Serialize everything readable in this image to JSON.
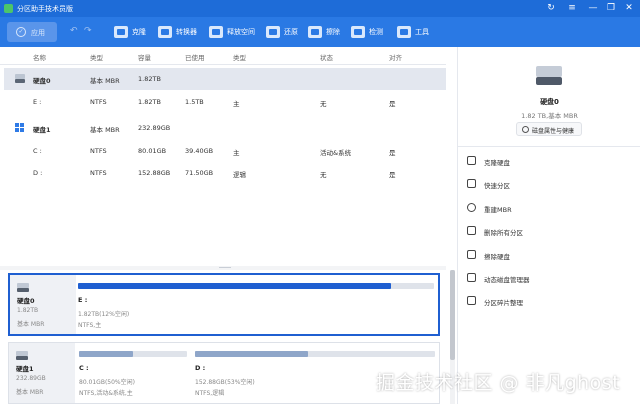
{
  "titlebar": {
    "title": "分区助手技术员版",
    "refresh_glyph": "↻",
    "menu_glyph": "≡",
    "minimize_glyph": "—",
    "restore_glyph": "❐",
    "close_glyph": "✕"
  },
  "toolbar": {
    "apply_label": "应用",
    "undo_glyph": "↶",
    "redo_glyph": "↷",
    "items": [
      {
        "label": "克隆",
        "icon": "clone-icon"
      },
      {
        "label": "转换器",
        "icon": "convert-icon"
      },
      {
        "label": "释放空间",
        "icon": "free-space-icon"
      },
      {
        "label": "还原",
        "icon": "restore-icon"
      },
      {
        "label": "擦除",
        "icon": "wipe-icon"
      },
      {
        "label": "检测",
        "icon": "check-icon"
      },
      {
        "label": "工具",
        "icon": "tools-icon"
      }
    ]
  },
  "table": {
    "headers": [
      "名称",
      "类型",
      "容量",
      "已使用",
      "类型",
      "状态",
      "对齐"
    ],
    "rows": [
      {
        "name": "硬盘0",
        "type": "基本 MBR",
        "capacity": "1.82TB",
        "used": "",
        "fstype": "",
        "status": "",
        "align": ""
      },
      {
        "name": "E :",
        "type": "NTFS",
        "capacity": "1.82TB",
        "used": "1.5TB",
        "fstype": "主",
        "status": "无",
        "align": "是"
      },
      {
        "name": "硬盘1",
        "type": "基本 MBR",
        "capacity": "232.89GB",
        "used": "",
        "fstype": "",
        "status": "",
        "align": ""
      },
      {
        "name": "C :",
        "type": "NTFS",
        "capacity": "80.01GB",
        "used": "39.40GB",
        "fstype": "主",
        "status": "活动&系统",
        "align": "是"
      },
      {
        "name": "D :",
        "type": "NTFS",
        "capacity": "152.88GB",
        "used": "71.50GB",
        "fstype": "逻辑",
        "status": "无",
        "align": "是"
      }
    ]
  },
  "disks": [
    {
      "name": "硬盘0",
      "size": "1.82TB",
      "type": "基本 MBR",
      "partitions": [
        {
          "name": "E :",
          "cap": "1.82TB(12%空闲)",
          "fs": "NTFS,主",
          "used_fraction": 0.88,
          "fill_color": "#1f5fd1"
        }
      ]
    },
    {
      "name": "硬盘1",
      "size": "232.89GB",
      "type": "基本 MBR",
      "partitions": [
        {
          "name": "C :",
          "cap": "80.01GB(50%空闲)",
          "fs": "NTFS,活动&系统,主",
          "used_fraction": 0.5,
          "fill_color": "#8fa6c9"
        },
        {
          "name": "D :",
          "cap": "152.88GB(53%空闲)",
          "fs": "NTFS,逻辑",
          "used_fraction": 0.47,
          "fill_color": "#8fa6c9"
        }
      ]
    }
  ],
  "right_panel": {
    "disk_name": "硬盘0",
    "disk_sub": "1.82 TB,基本 MBR",
    "properties_label": "磁盘属性与健康",
    "operations": [
      {
        "label": "克隆硬盘",
        "icon": "clone-disk-icon"
      },
      {
        "label": "快速分区",
        "icon": "quick-partition-icon"
      },
      {
        "label": "重建MBR",
        "icon": "rebuild-mbr-icon"
      },
      {
        "label": "删除所有分区",
        "icon": "delete-all-partitions-icon"
      },
      {
        "label": "擦除硬盘",
        "icon": "wipe-disk-icon"
      },
      {
        "label": "动态磁盘管理器",
        "icon": "dynamic-disk-icon"
      },
      {
        "label": "分区碎片整理",
        "icon": "defrag-icon"
      }
    ]
  },
  "watermark": "掘金技术社区 @ 非凡ghost",
  "colors": {
    "titlebar": "#1e6cd8",
    "toolbar": "#2a79e4",
    "accent": "#1f5fd1"
  }
}
